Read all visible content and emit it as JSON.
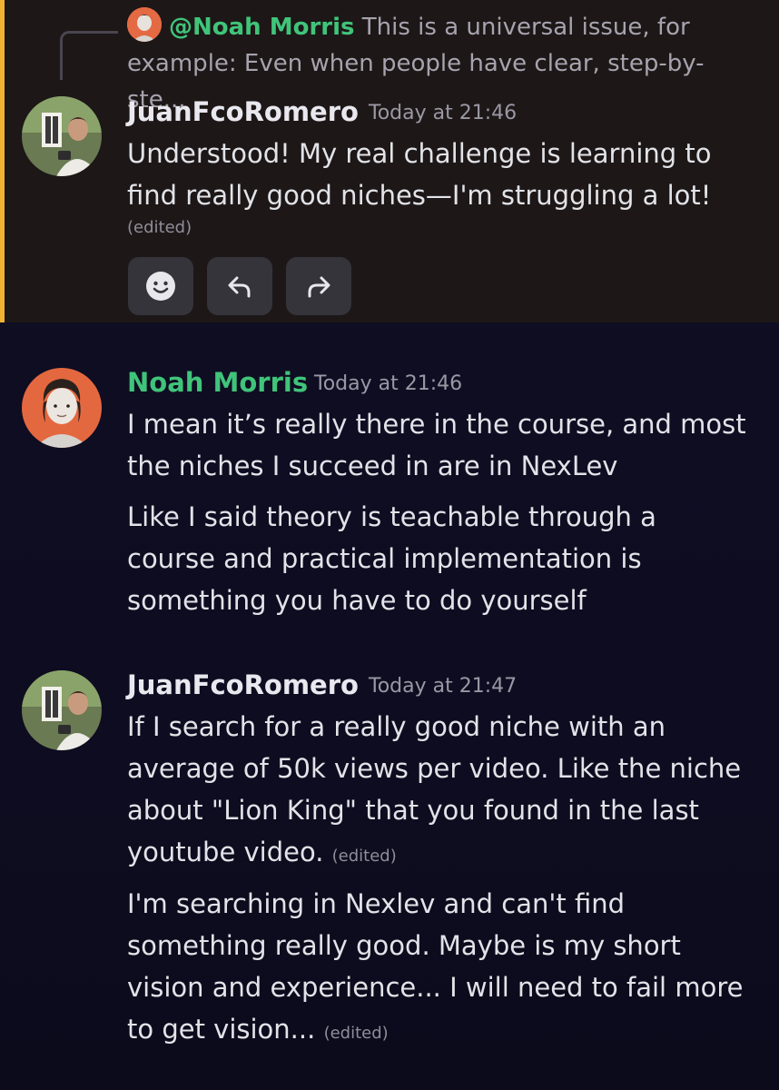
{
  "reply": {
    "mention": "@Noah Morris",
    "preview": "This is a universal issue, for example: Even when people have clear, step-by-ste..."
  },
  "messages": [
    {
      "author": "JuanFcoRomero",
      "author_color": "#e9e8ef",
      "time": "Today at 21:46",
      "paragraphs": [
        "Understood! My real challenge is learning to find really good niches—I'm struggling a lot!"
      ],
      "edited": "(edited)"
    },
    {
      "author": "Noah Morris",
      "author_color": "#40c47a",
      "time": "Today at 21:46",
      "paragraphs": [
        "I mean it’s really there in the course, and most the niches I succeed in are in NexLev",
        "Like I said theory is teachable through a course and practical implementation is something you have to do yourself"
      ]
    },
    {
      "author": "JuanFcoRomero",
      "author_color": "#e9e8ef",
      "time": "Today at 21:47",
      "paragraphs": [
        "If I search for a really good niche with an average of 50k views per video. Like the niche about \"Lion King\" that you found in the last youtube video.",
        "I'm searching in Nexlev and can't find something really good. Maybe is my short vision and experience... I will need to fail more to get vision..."
      ],
      "edited_1": "(edited)",
      "edited_2": "(edited)"
    }
  ],
  "actions": [
    {
      "icon": "emoji-reaction-icon"
    },
    {
      "icon": "reply-icon"
    },
    {
      "icon": "forward-icon"
    }
  ],
  "colors": {
    "highlight_bar": "#f0b232",
    "mention": "#40c47a",
    "highlight_bg": "#1d1717"
  }
}
